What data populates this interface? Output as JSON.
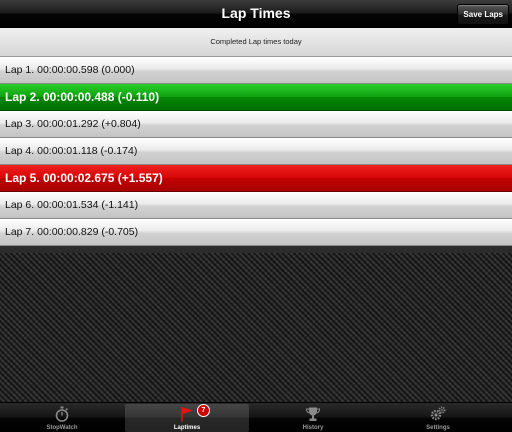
{
  "navbar": {
    "title": "Lap Times",
    "save_label": "Save Laps"
  },
  "header": {
    "text": "Completed Lap times today"
  },
  "laps": [
    {
      "label": "Lap 1. 00:00:00.598 (0.000)",
      "status": "normal"
    },
    {
      "label": "Lap 2. 00:00:00.488 (-0.110)",
      "status": "best"
    },
    {
      "label": "Lap 3. 00:00:01.292 (+0.804)",
      "status": "normal"
    },
    {
      "label": "Lap 4. 00:00:01.118 (-0.174)",
      "status": "normal"
    },
    {
      "label": "Lap 5. 00:00:02.675 (+1.557)",
      "status": "worst"
    },
    {
      "label": "Lap 6. 00:00:01.534 (-1.141)",
      "status": "normal"
    },
    {
      "label": "Lap 7. 00:00:00.829 (-0.705)",
      "status": "normal"
    }
  ],
  "tabs": [
    {
      "label": "StopWatch",
      "icon": "stopwatch-icon",
      "selected": false
    },
    {
      "label": "Laptimes",
      "icon": "flag-icon",
      "selected": true,
      "badge": "7"
    },
    {
      "label": "History",
      "icon": "trophy-icon",
      "selected": false
    },
    {
      "label": "Settings",
      "icon": "gears-icon",
      "selected": false
    }
  ],
  "colors": {
    "best": "#0a9a0a",
    "worst": "#cc0000",
    "badge": "#d10000"
  }
}
